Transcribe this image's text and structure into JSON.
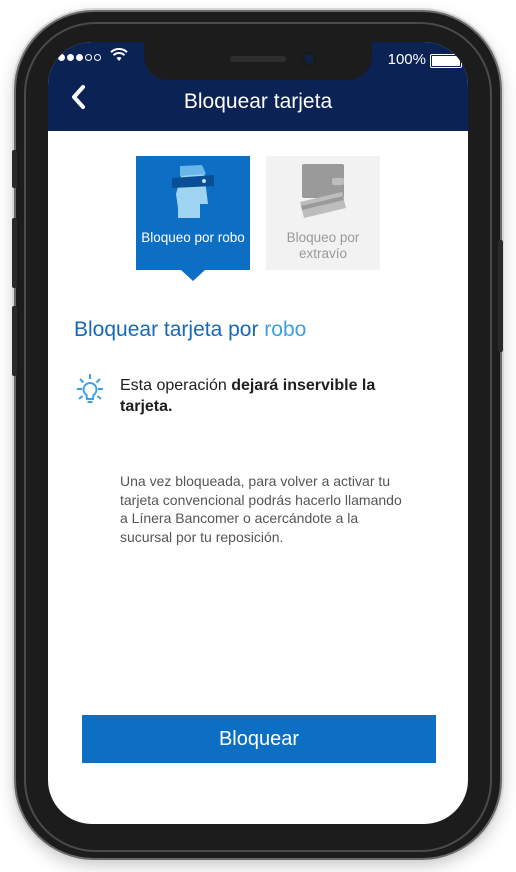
{
  "status_bar": {
    "battery_text": "100%",
    "battery_level": 1.0,
    "signal_bars_filled": 3,
    "signal_bars_total": 5
  },
  "nav": {
    "title": "Bloquear tarjeta",
    "back_icon": "chevron-left-icon"
  },
  "options": [
    {
      "label": "Bloqueo por robo",
      "icon": "thief-icon",
      "selected": true
    },
    {
      "label": "Bloqueo por extravío",
      "icon": "wallet-icon",
      "selected": false
    }
  ],
  "heading": {
    "prefix": "Bloquear tarjeta por",
    "emphasis": "robo"
  },
  "warning": {
    "icon": "lightbulb-icon",
    "text_before": "Esta operación ",
    "text_bold": "dejará inservible la tarjeta."
  },
  "info": "Una vez bloqueada, para volver a activar tu tarjeta convencional podrás hacerlo llamando a Línera Bancomer o acercándote a la sucursal por tu reposición.",
  "primary_button": {
    "label": "Bloquear"
  },
  "colors": {
    "nav_bg": "#0a2254",
    "primary": "#0d6fc4",
    "accent": "#3ea0e2"
  }
}
